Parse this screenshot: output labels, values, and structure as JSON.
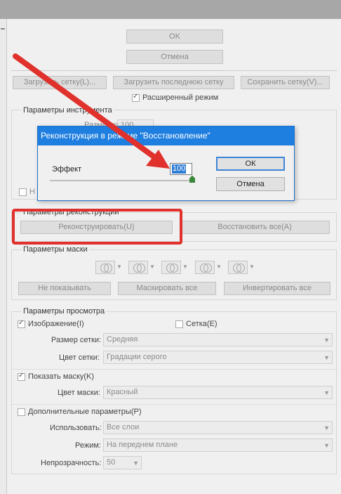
{
  "top": {
    "ok_label": "OK",
    "cancel_label": "Отмена",
    "load_mesh_label": "Загрузить сетку(L)...",
    "load_last_mesh_label": "Загрузить последнюю сетку",
    "save_mesh_label": "Сохранить сетку(V)...",
    "advanced_mode_label": "Расширенный режим"
  },
  "tool_params": {
    "title": "Параметры инструмента",
    "size_label": "Размер ки",
    "size_value": "100",
    "partial_label": "Н"
  },
  "dialog": {
    "title": "Реконструкция в режиме \"Восстановление\"",
    "effect_label": "Эффект",
    "effect_value": "100",
    "slider_value": 1.0,
    "ok_label": "ОК",
    "cancel_label": "Отмена"
  },
  "recon": {
    "title": "Параметры реконструкции",
    "reconstruct_label": "Реконструировать(U)",
    "restore_all_label": "Восстановить все(A)"
  },
  "mask": {
    "title": "Параметры маски",
    "none_label": "Не показывать",
    "mask_all_label": "Маскировать все",
    "invert_all_label": "Инвертировать все"
  },
  "view": {
    "title": "Параметры просмотра",
    "image_label": "Изображение(I)",
    "mesh_label": "Сетка(E)",
    "mesh_size_label": "Размер сетки:",
    "mesh_size_value": "Средняя",
    "mesh_color_label": "Цвет сетки:",
    "mesh_color_value": "Градации серого",
    "show_mask_label": "Показать маску(K)",
    "mask_color_label": "Цвет маски:",
    "mask_color_value": "Красный",
    "extra_label": "Дополнительные параметры(P)",
    "use_label": "Использовать:",
    "use_value": "Все слои",
    "mode_label": "Режим:",
    "mode_value": "На переднем плане",
    "opacity_label": "Непрозрачность:",
    "opacity_value": "50"
  },
  "colors": {
    "dialog_title_bg": "#1f7fe0",
    "arrow": "#e0312c",
    "highlight_border": "#e0312c"
  }
}
